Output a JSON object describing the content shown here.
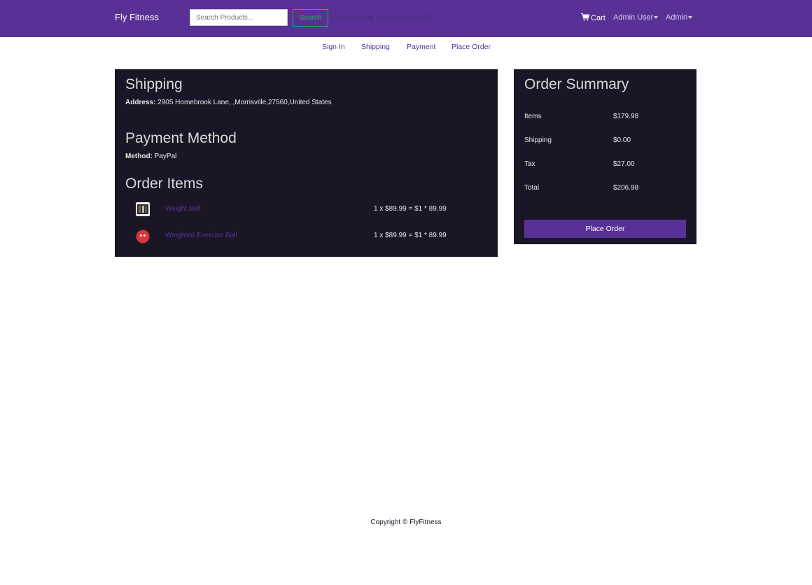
{
  "header": {
    "brand": "Fly Fitness",
    "search_placeholder": "Search Products...",
    "search_button": "Search",
    "promo_text": "Free shipping on orders over $50",
    "cart_label": "Cart",
    "user_menu": "Admin User",
    "admin_menu": "Admin",
    "icons": {
      "cart": "shopping-cart-icon",
      "dropdown": "caret-down-icon"
    }
  },
  "steps": [
    "Sign In",
    "Shipping",
    "Payment",
    "Place Order"
  ],
  "shipping": {
    "heading": "Shipping",
    "address_label": "Address:",
    "address_value": "2905 Homebrook Lane, ,Morrisville,27560,United States"
  },
  "payment": {
    "heading": "Payment Method",
    "method_label": "Method:",
    "method_value": "PayPal"
  },
  "order_items": {
    "heading": "Order Items",
    "items": [
      {
        "name": "Weight Belt",
        "price_line": "1 x $89.99 = $1 * 89.99"
      },
      {
        "name": "Weighted Exercise Ball",
        "price_line": "1 x $89.99 = $1 * 89.99"
      }
    ]
  },
  "summary": {
    "heading": "Order Summary",
    "rows": [
      {
        "label": "Items",
        "value": "$179.98"
      },
      {
        "label": "Shipping",
        "value": "$0.00"
      },
      {
        "label": "Tax",
        "value": "$27.00"
      },
      {
        "label": "Total",
        "value": "$206.98"
      }
    ],
    "place_order_button": "Place Order"
  },
  "footer": {
    "text": "Copyright © FlyFitness"
  },
  "colors": {
    "primary": "#593196",
    "panel": "#1a1625",
    "success": "#13b955"
  }
}
